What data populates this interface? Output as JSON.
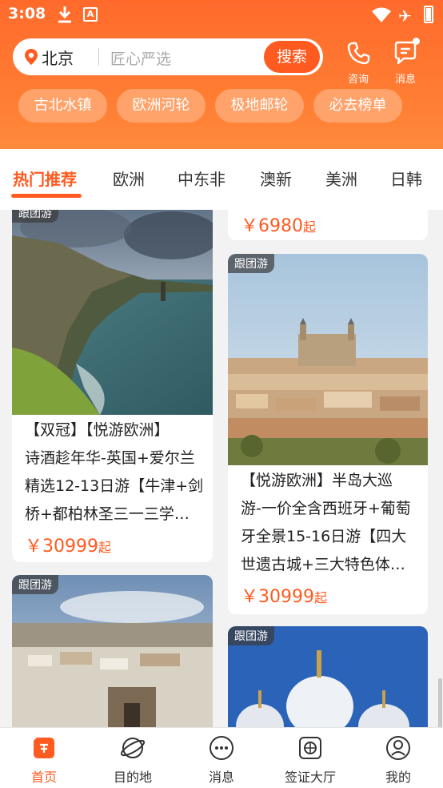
{
  "status": {
    "time": "3:08",
    "ac_letter": "A"
  },
  "header": {
    "city": "北京",
    "search_placeholder": "匠心严选",
    "search_button": "搜索",
    "consult_label": "咨询",
    "message_label": "消息",
    "chips": [
      "古北水镇",
      "欧洲河轮",
      "极地邮轮",
      "必去榜单"
    ]
  },
  "tabs": [
    "热门推荐",
    "欧洲",
    "中东非",
    "澳新",
    "美洲",
    "日韩"
  ],
  "feed": {
    "top_left_tag": "跟团游",
    "top_right_price": "￥6980",
    "price_suffix": "起",
    "cards": [
      {
        "tag": "跟团游",
        "title_lines": [
          "【双冠】【悦游欧洲】",
          "诗酒趁年华-英国+爱尔兰",
          "精选12-13日游【牛津+剑",
          "桥+都柏林圣三一三学…"
        ],
        "price": "￥30999"
      },
      {
        "tag": "跟团游",
        "title_lines": [
          "【悦游欧洲】半岛大巡",
          "游-一价全含西班牙+葡萄",
          "牙全景15-16日游【四大",
          "世遗古城+三大特色体…"
        ],
        "price": "￥30999"
      },
      {
        "tag": "跟团游"
      },
      {
        "tag": "跟团游"
      }
    ]
  },
  "nav": [
    "首页",
    "目的地",
    "消息",
    "签证大厅",
    "我的"
  ],
  "colors": {
    "brand": "#ff5a1f",
    "header": "#ff7b32",
    "chip": "#ffa36b"
  }
}
